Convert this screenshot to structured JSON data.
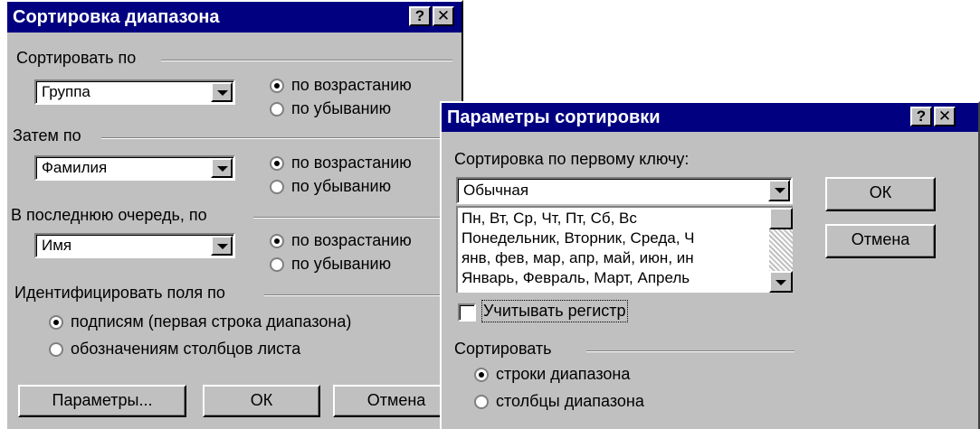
{
  "sort_dialog": {
    "title": "Сортировка диапазона",
    "help_button": "?",
    "close_button": "✕",
    "sort_by": {
      "label": "Сортировать по",
      "value": "Группа",
      "asc": "по возрастанию",
      "desc": "по убыванию",
      "selected": "asc"
    },
    "then_by": {
      "label": "Затем по",
      "value": "Фамилия",
      "asc": "по возрастанию",
      "desc": "по убыванию",
      "selected": "asc"
    },
    "last_by": {
      "label": "В последнюю очередь, по",
      "value": "Имя",
      "asc": "по возрастанию",
      "desc": "по убыванию",
      "selected": "asc"
    },
    "identify": {
      "label": "Идентифицировать поля по",
      "opt1": "подписям (первая строка диапазона)",
      "opt2": "обозначениям столбцов листа",
      "selected": "opt1"
    },
    "buttons": {
      "params": "Параметры...",
      "ok": "ОК",
      "cancel": "Отмена"
    }
  },
  "options_dialog": {
    "title": "Параметры сортировки",
    "help_button": "?",
    "close_button": "✕",
    "first_key_label": "Сортировка по первому ключу:",
    "first_key_value": "Обычная",
    "list_items": [
      "Пн, Вт, Ср, Чт, Пт, Сб, Вс",
      "Понедельник, Вторник, Среда, Ч",
      "янв, фев, мар, апр, май, июн, ин",
      "Январь, Февраль, Март, Апрель"
    ],
    "case_sensitive_label": "Учитывать регистр",
    "case_sensitive": false,
    "orientation_label": "Сортировать",
    "orient_rows": "строки диапазона",
    "orient_cols": "столбцы диапазона",
    "orientation_selected": "rows",
    "buttons": {
      "ok": "ОК",
      "cancel": "Отмена"
    }
  }
}
